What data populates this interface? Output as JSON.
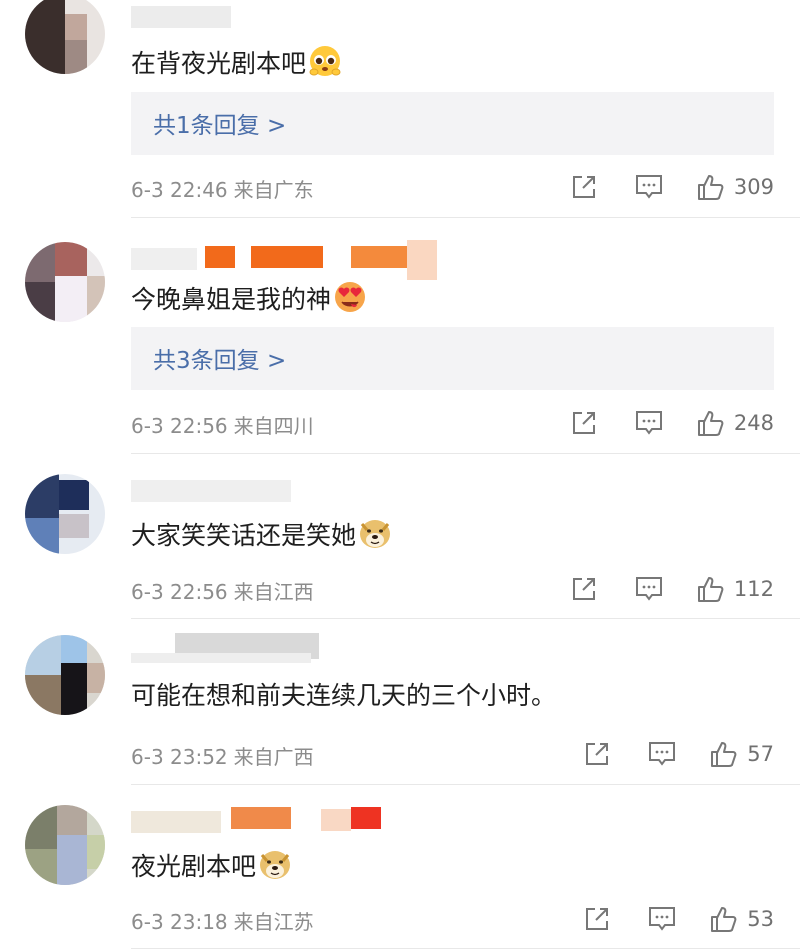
{
  "comments": [
    {
      "text": "在背夜光剧本吧",
      "reply_link": "共1条回复 >",
      "time": "6-3 22:46",
      "location": "来自广东",
      "likes": "309",
      "emoji": "pleading-face"
    },
    {
      "text": "今晚鼻姐是我的神",
      "reply_link": "共3条回复 >",
      "time": "6-3 22:56",
      "location": "来自四川",
      "likes": "248",
      "emoji": "heart-eyes-face"
    },
    {
      "text": "大家笑笑话还是笑她",
      "time": "6-3 22:56",
      "location": "来自江西",
      "likes": "112",
      "emoji": "doge-face"
    },
    {
      "text": "可能在想和前夫连续几天的三个小时。",
      "time": "6-3 23:52",
      "location": "来自广西",
      "likes": "57"
    },
    {
      "text": "夜光剧本吧",
      "time": "6-3 23:18",
      "location": "来自江苏",
      "likes": "53",
      "emoji": "doge-face"
    }
  ],
  "colors": {
    "reply_link": "#4a6ea9",
    "meta_text": "#8c8c8c",
    "reply_bg": "#f3f3f5",
    "username_orange": "#f26a1b"
  }
}
